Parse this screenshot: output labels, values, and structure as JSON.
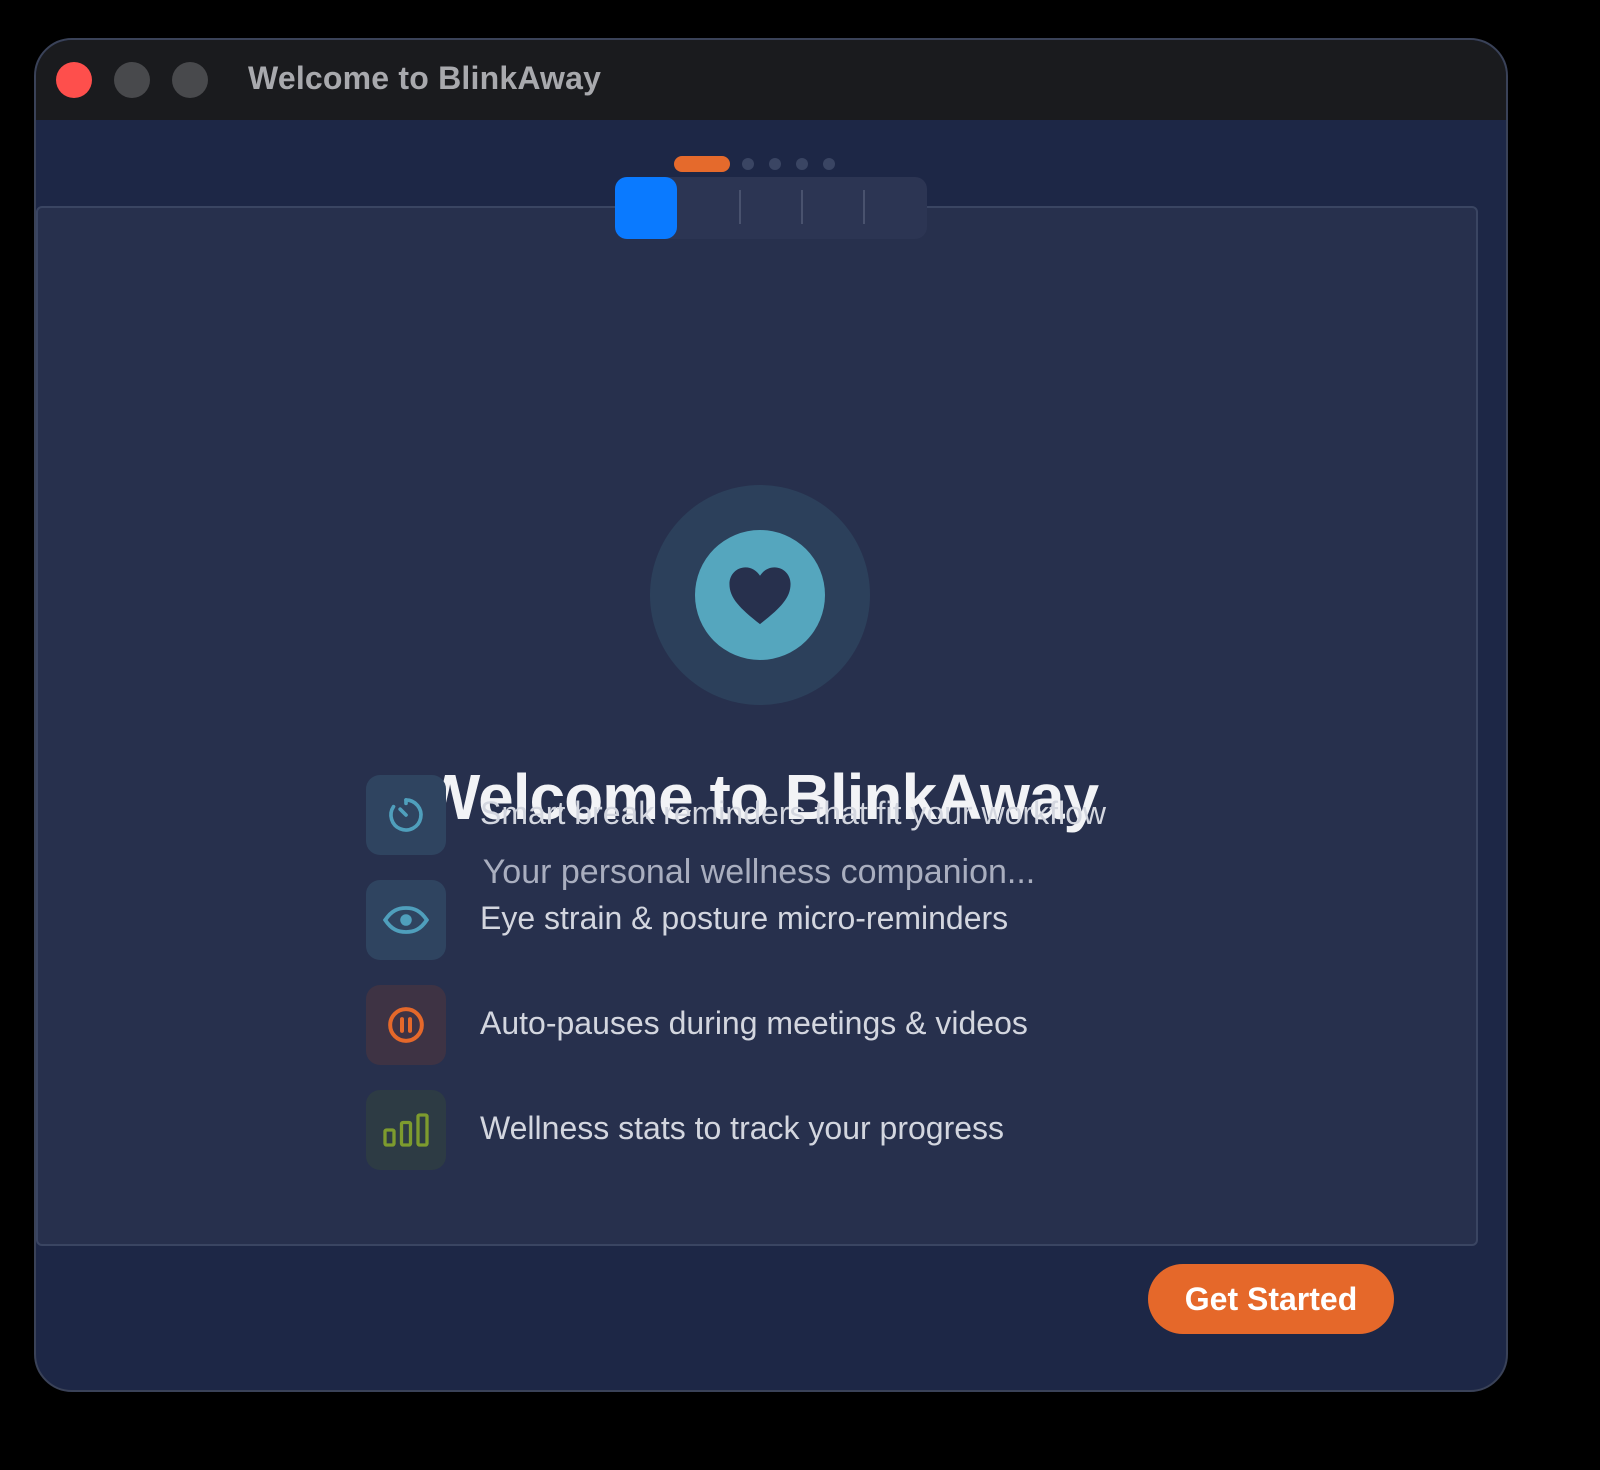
{
  "window": {
    "title": "Welcome to BlinkAway"
  },
  "progress": {
    "total_steps": 5,
    "current_step": 1
  },
  "hero": {
    "icon": "heart-icon",
    "title": "Welcome to BlinkAway",
    "subtitle": "Your personal wellness companion..."
  },
  "features": [
    {
      "icon": "timer-icon",
      "text": "Smart break reminders that fit your workflow",
      "color": "#4f9fbc"
    },
    {
      "icon": "eye-icon",
      "text": "Eye strain & posture micro-reminders",
      "color": "#4f9fbc"
    },
    {
      "icon": "pause-circle-icon",
      "text": "Auto-pauses during meetings & videos",
      "color": "#e5682a"
    },
    {
      "icon": "bar-chart-icon",
      "text": "Wellness stats to track your progress",
      "color": "#7d9b2e"
    }
  ],
  "footer": {
    "cta_label": "Get Started"
  },
  "colors": {
    "accent_orange": "#e5682a",
    "accent_blue": "#0a7aff",
    "hero_teal": "#55a6be"
  }
}
